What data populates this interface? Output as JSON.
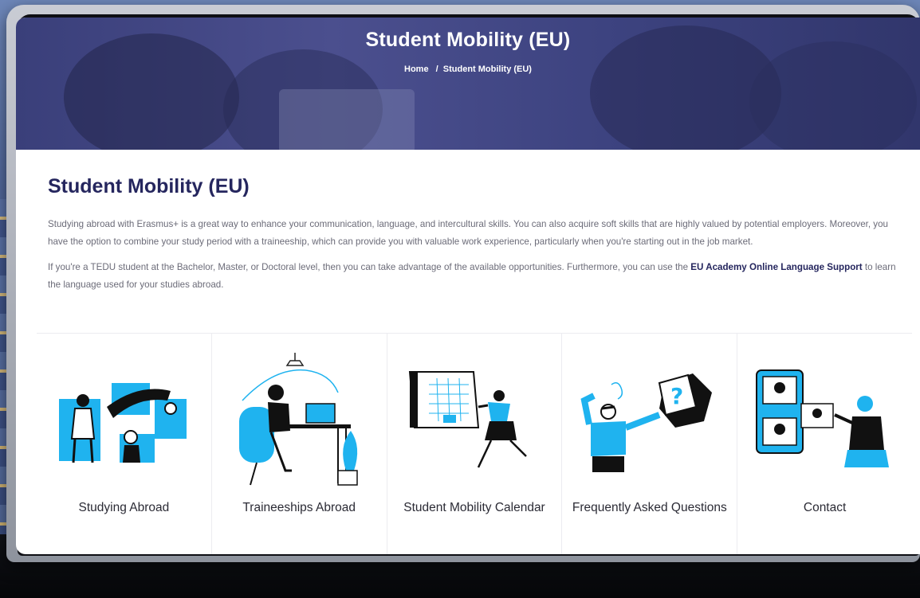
{
  "hero": {
    "title": "Student Mobility (EU)",
    "breadcrumb_home": "Home",
    "breadcrumb_separator": "/",
    "breadcrumb_current": "Student Mobility (EU)"
  },
  "main": {
    "title": "Student Mobility (EU)",
    "paragraph1": "Studying abroad with Erasmus+ is a great way to enhance your communication, language, and intercultural skills. You can also acquire soft skills that are highly valued by potential employers. Moreover, you have the option to combine your study period with a traineeship, which can provide you with valuable work experience, particularly when you're starting out in the job market.",
    "paragraph2_before": "If you're a TEDU student at the Bachelor, Master, or Doctoral level, then you can take advantage of the available opportunities. Furthermore, you can use the ",
    "paragraph2_link": "EU Academy Online Language Support",
    "paragraph2_after": " to learn the language used for your studies abroad."
  },
  "cards": [
    {
      "label": "Studying Abroad",
      "icon": "group-collaboration-illustration"
    },
    {
      "label": "Traineeships Abroad",
      "icon": "remote-work-illustration"
    },
    {
      "label": "Student Mobility Calendar",
      "icon": "calendar-illustration"
    },
    {
      "label": "Frequently Asked Questions",
      "icon": "question-box-illustration"
    },
    {
      "label": "Contact",
      "icon": "video-call-illustration"
    }
  ],
  "colors": {
    "accent": "#1fb3ef",
    "brand_navy": "#25265e",
    "hero_overlay": "#3f4585",
    "text_gray": "#6b6b78"
  }
}
